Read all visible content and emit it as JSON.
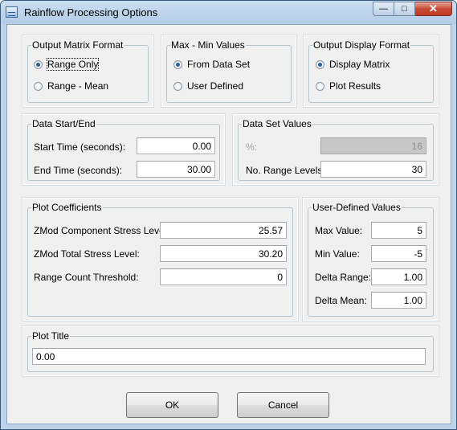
{
  "window": {
    "title": "Rainflow Processing Options"
  },
  "output_matrix_format": {
    "legend": "Output Matrix Format",
    "options": [
      {
        "label": "Range Only",
        "selected": true
      },
      {
        "label": "Range - Mean",
        "selected": false
      }
    ]
  },
  "max_min_values": {
    "legend": "Max - Min Values",
    "options": [
      {
        "label": "From Data Set",
        "selected": true
      },
      {
        "label": "User Defined",
        "selected": false
      }
    ]
  },
  "output_display_format": {
    "legend": "Output Display Format",
    "options": [
      {
        "label": "Display Matrix",
        "selected": true
      },
      {
        "label": "Plot Results",
        "selected": false
      }
    ]
  },
  "data_start_end": {
    "legend": "Data Start/End",
    "start_label": "Start Time (seconds):",
    "start_value": "0.00",
    "end_label": "End Time (seconds):",
    "end_value": "30.00"
  },
  "data_set_values": {
    "legend": "Data Set Values",
    "percent_label": "%:",
    "percent_value": "16",
    "levels_label": "No. Range Levels:",
    "levels_value": "30"
  },
  "plot_coefficients": {
    "legend": "Plot Coefficients",
    "component_label": "ZMod Component Stress Level:",
    "component_value": "25.57",
    "total_label": "ZMod Total Stress Level:",
    "total_value": "30.20",
    "threshold_label": "Range Count Threshold:",
    "threshold_value": "0"
  },
  "user_defined_values": {
    "legend": "User-Defined Values",
    "max_label": "Max Value:",
    "max_value": "5",
    "min_label": "Min Value:",
    "min_value": "-5",
    "delta_range_label": "Delta Range:",
    "delta_range_value": "1.00",
    "delta_mean_label": "Delta Mean:",
    "delta_mean_value": "1.00"
  },
  "plot_title": {
    "legend": "Plot Title",
    "value": "0.00"
  },
  "buttons": {
    "ok": "OK",
    "cancel": "Cancel"
  }
}
